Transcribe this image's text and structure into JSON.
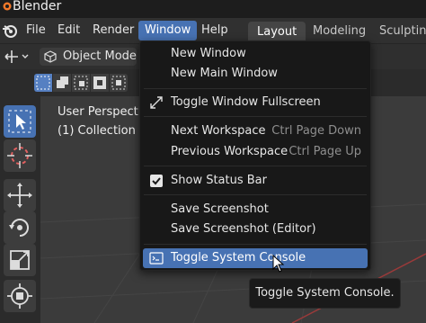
{
  "window": {
    "title": "Blender"
  },
  "menubar": {
    "items": [
      {
        "label": "File"
      },
      {
        "label": "Edit"
      },
      {
        "label": "Render"
      },
      {
        "label": "Window",
        "active": true
      },
      {
        "label": "Help"
      }
    ],
    "workspace_tabs": [
      {
        "label": "Layout",
        "active": true
      },
      {
        "label": "Modeling"
      },
      {
        "label": "Sculpting"
      }
    ]
  },
  "header": {
    "mode_selector": {
      "label": "Object Mode",
      "icon": "cube-icon"
    }
  },
  "viewport": {
    "view_name": "User Perspective",
    "collection": "(1) Collection"
  },
  "toolbar": {
    "tools": [
      {
        "icon": "select-box-icon",
        "active": true
      },
      {
        "icon": "cursor-icon"
      },
      {
        "icon": "move-icon"
      },
      {
        "icon": "rotate-icon"
      },
      {
        "icon": "scale-icon"
      },
      {
        "icon": "transform-icon"
      }
    ]
  },
  "window_menu": {
    "items": [
      {
        "label": "New Window"
      },
      {
        "label": "New Main Window"
      },
      {
        "label": "Toggle Window Fullscreen",
        "icon": "fullscreen-icon"
      },
      {
        "label": "Next Workspace",
        "shortcut": "Ctrl Page Down"
      },
      {
        "label": "Previous Workspace",
        "shortcut": "Ctrl Page Up"
      },
      {
        "label": "Show Status Bar",
        "icon": "checkbox-checked-icon",
        "checked": true
      },
      {
        "label": "Save Screenshot"
      },
      {
        "label": "Save Screenshot (Editor)"
      },
      {
        "label": "Toggle System Console",
        "icon": "console-icon",
        "highlighted": true
      }
    ]
  },
  "tooltip": {
    "text": "Toggle System Console."
  },
  "colors": {
    "accent": "#4772b3",
    "menu_bg": "#181818",
    "app_bg": "#303030",
    "viewport_bg": "#3b3b3b",
    "axis_red": "#9a3a3a"
  }
}
